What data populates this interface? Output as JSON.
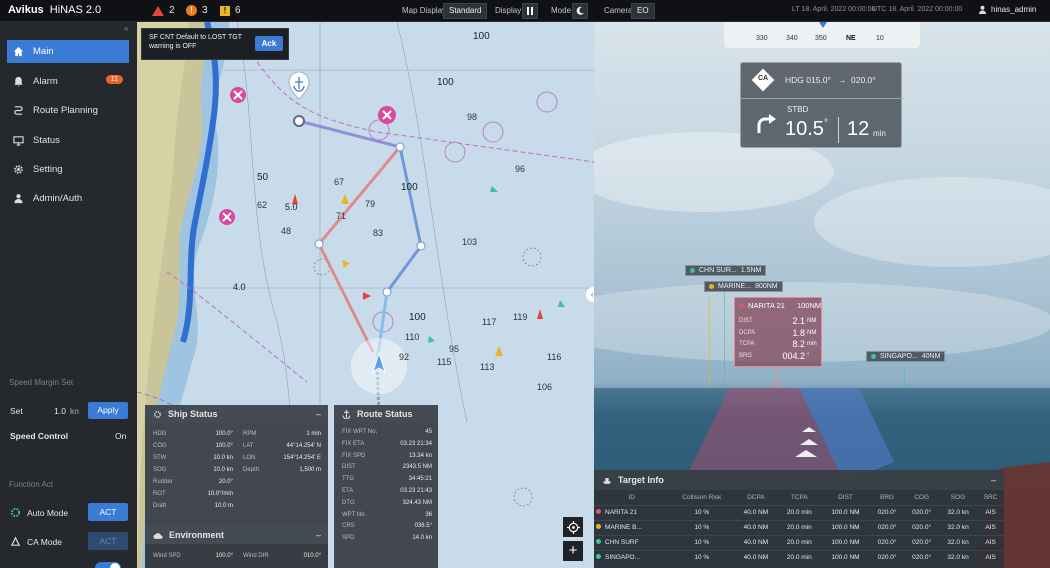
{
  "topbar": {
    "brand": "Avikus",
    "product": "HiNAS 2.0",
    "alert_red_count": "2",
    "alert_orange_count": "3",
    "alert_yellow_count": "6",
    "map_display_label": "Map Display",
    "map_display_value": "Standard",
    "display_label": "Display",
    "mode_label": "Mode",
    "camera_label": "Camera",
    "camera_value": "EO",
    "lt_time": "LT 18. April. 2022 00:00:00",
    "utc_time": "UTC 18. April. 2022 00:00:00",
    "user": "hinas_admin"
  },
  "sidebar": {
    "items": [
      {
        "label": "Main"
      },
      {
        "label": "Alarm",
        "badge": "11"
      },
      {
        "label": "Route Planning"
      },
      {
        "label": "Status"
      },
      {
        "label": "Setting"
      },
      {
        "label": "Admin/Auth"
      }
    ],
    "speed_margin": {
      "title": "Speed Margin Set",
      "set_label": "Set",
      "value": "1.0",
      "unit": "kn",
      "apply": "Apply"
    },
    "speed_control": {
      "label": "Speed Control",
      "value": "On"
    },
    "function_act": {
      "title": "Function Act",
      "auto_mode": "Auto Mode",
      "auto_btn": "ACT",
      "ca_mode": "CA Mode",
      "ca_btn": "ACT"
    }
  },
  "notice": {
    "text": "SF CNT Default to LOST TGT warning is OFF",
    "ack": "Ack"
  },
  "chart_depths": [
    "100",
    "100",
    "100",
    "98",
    "96",
    "67",
    "71",
    "79",
    "83",
    "103",
    "62",
    "48",
    "100",
    "117",
    "95",
    "110",
    "92",
    "115",
    "113",
    "119",
    "116",
    "106",
    "50",
    "5.0",
    "4.0"
  ],
  "ship_status": {
    "title": "Ship Status",
    "left": [
      [
        "HDG",
        "100.0°"
      ],
      [
        "COG",
        "100.0°"
      ],
      [
        "STW",
        "10.0 kn"
      ],
      [
        "SOG",
        "10.0 kn"
      ],
      [
        "Rudder",
        "20.0°"
      ],
      [
        "ROT",
        "10.0°/min"
      ],
      [
        "Draft",
        "10.0 m"
      ]
    ],
    "right": [
      [
        "RPM",
        "1 min"
      ],
      [
        "LAT",
        "44°14.254' N"
      ],
      [
        "LON",
        "154°14.254' E"
      ],
      [
        "Depth",
        "1,500 m"
      ]
    ]
  },
  "route_status": {
    "title": "Route Status",
    "rows": [
      [
        "FIX WPT No.",
        "45"
      ],
      [
        "FIX ETA",
        "03.23 21:34"
      ],
      [
        "FIX SPD",
        "13.34 kn"
      ],
      [
        "DIST",
        "2343.5 NM"
      ],
      [
        "TTG",
        "34:45:21"
      ],
      [
        "ETA",
        "03.23 21:43"
      ],
      [
        "DTG",
        "324.43 NM"
      ],
      [
        "WPT No.",
        "36"
      ],
      [
        "CRS",
        "036.5°"
      ],
      [
        "SPD",
        "14.0 kn"
      ]
    ]
  },
  "environment": {
    "title": "Environment",
    "wind_spd_label": "Wind SPD",
    "wind_spd": "100.0°",
    "wind_dir_label": "Wind DIR",
    "wind_dir": "010.0°"
  },
  "compass": {
    "ticks": [
      "330",
      "340",
      "350",
      "NE",
      "10"
    ]
  },
  "heading_card": {
    "badge": "CA",
    "hdg_label": "HDG 015.0°",
    "arrow": "→",
    "target": "020.0°",
    "dir": "STBD",
    "angle": "10.5",
    "deg": "°",
    "minutes": "12",
    "min_unit": "min"
  },
  "targets": [
    {
      "name": "CHN SUR...",
      "dist": "1.5NM",
      "color": "#3fc29a"
    },
    {
      "name": "MARINE...",
      "dist": "800NM",
      "color": "#e8b823"
    },
    {
      "name": "NARITA 21",
      "dist": "100NM",
      "color": "#e0566b"
    },
    {
      "name": "SINGAPO...",
      "dist": "40NM",
      "color": "#3fc29a"
    }
  ],
  "narita_detail": {
    "rows": [
      [
        "DIST",
        "2.1",
        "NM"
      ],
      [
        "DCPA",
        "1.8",
        "NM"
      ],
      [
        "TCPA",
        "8.2",
        "min"
      ],
      [
        "BRG",
        "004.2",
        "°"
      ]
    ]
  },
  "target_info": {
    "title": "Target Info",
    "columns": [
      "ID",
      "Collision Risk",
      "DCPA",
      "TCPA",
      "DIST",
      "BRG",
      "COG",
      "SOG",
      "SRC"
    ],
    "rows": [
      {
        "color": "#e0566b",
        "cells": [
          "NARITA 21",
          "10 %",
          "40.0 NM",
          "20.0 min",
          "100.0 NM",
          "020.0°",
          "020.0°",
          "32.0 kn",
          "AIS"
        ]
      },
      {
        "color": "#e8b823",
        "cells": [
          "MARINE B...",
          "10 %",
          "40.0 NM",
          "20.0 min",
          "100.0 NM",
          "020.0°",
          "020.0°",
          "32.0 kn",
          "AIS"
        ]
      },
      {
        "color": "#3fc29a",
        "cells": [
          "CHN SURF",
          "10 %",
          "40.0 NM",
          "20.0 min",
          "100.0 NM",
          "020.0°",
          "020.0°",
          "32.0 kn",
          "AIS"
        ]
      },
      {
        "color": "#3fc29a",
        "cells": [
          "SINGAPO...",
          "10 %",
          "40.0 NM",
          "20.0 min",
          "100.0 NM",
          "020.0°",
          "020.0°",
          "32.0 kn",
          "AIS"
        ]
      }
    ]
  },
  "colors": {
    "accent": "#3a7bd5",
    "route": "#6f97d9",
    "route_red": "#e08b8b",
    "land": "#c9c49a",
    "danger": "#d84a9e"
  }
}
